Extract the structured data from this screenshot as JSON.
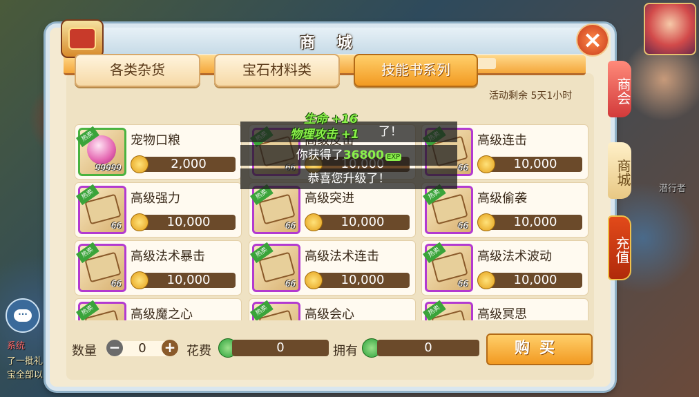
{
  "background": {
    "left_texts": [
      "系统",
      "了一批礼",
      "宝全部以"
    ],
    "right_text": "潜行者",
    "chat_icon": "chat-bubble-icon"
  },
  "window": {
    "title": "商 城",
    "close_icon": "close-x-icon"
  },
  "tabs": [
    {
      "label": "各类杂货",
      "active": false
    },
    {
      "label": "宝石材料类",
      "active": false
    },
    {
      "label": "技能书系列",
      "active": true
    }
  ],
  "activity_remaining": "活动剩余 5天1小时",
  "items": [
    {
      "name": "宠物口粮",
      "price": "2,000",
      "count": "99999",
      "badge": "热卖",
      "icon": "pet-food-icon"
    },
    {
      "name": "高级反击",
      "price": "10,000",
      "count": "66",
      "badge": "热卖",
      "icon": "skill-book-icon"
    },
    {
      "name": "高级连击",
      "price": "10,000",
      "count": "66",
      "badge": "热卖",
      "icon": "skill-book-icon"
    },
    {
      "name": "高级强力",
      "price": "10,000",
      "count": "66",
      "badge": "热卖",
      "icon": "skill-book-icon"
    },
    {
      "name": "高级突进",
      "price": "10,000",
      "count": "66",
      "badge": "热卖",
      "icon": "skill-book-icon"
    },
    {
      "name": "高级偷袭",
      "price": "10,000",
      "count": "66",
      "badge": "热卖",
      "icon": "skill-book-icon"
    },
    {
      "name": "高级法术暴击",
      "price": "10,000",
      "count": "66",
      "badge": "热卖",
      "icon": "skill-book-icon"
    },
    {
      "name": "高级法术连击",
      "price": "10,000",
      "count": "66",
      "badge": "热卖",
      "icon": "skill-book-icon"
    },
    {
      "name": "高级法术波动",
      "price": "10,000",
      "count": "66",
      "badge": "热卖",
      "icon": "skill-book-icon"
    },
    {
      "name": "高级魔之心",
      "price": "",
      "count": "",
      "badge": "热卖",
      "icon": "skill-book-icon"
    },
    {
      "name": "高级会心",
      "price": "",
      "count": "",
      "badge": "热卖",
      "icon": "skill-book-icon"
    },
    {
      "name": "高级冥思",
      "price": "",
      "count": "",
      "badge": "热卖",
      "icon": "skill-book-icon"
    }
  ],
  "bottom": {
    "quantity_label": "数量",
    "quantity_value": "0",
    "minus_label": "−",
    "plus_label": "+",
    "cost_label": "花费",
    "cost_value": "0",
    "owned_label": "拥有",
    "owned_value": "0",
    "buy_label": "购买"
  },
  "side_tabs": [
    "商会",
    "商城",
    "充值"
  ],
  "notifications": {
    "float_1": "生命 +16",
    "float_2": "物理攻击 +1",
    "toast_1": "了！",
    "toast_2_prefix": "你获得了",
    "toast_2_value": "36800",
    "toast_2_suffix": "EXP",
    "toast_3": "恭喜您升级了！"
  },
  "colors": {
    "accent": "#f29a22",
    "price_bg": "#6b4a2a",
    "badge": "#3aa43a",
    "exp_green": "#8af04a"
  }
}
